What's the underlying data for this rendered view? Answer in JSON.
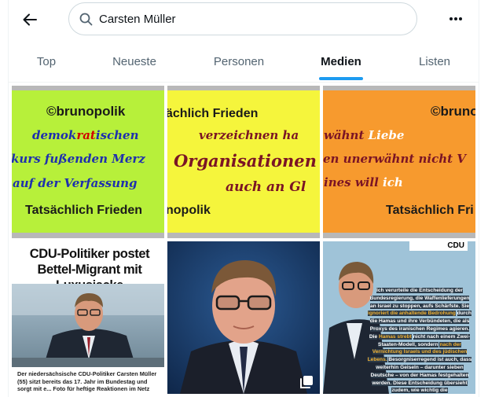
{
  "header": {
    "back_icon": "arrow-left-icon",
    "search_value": "Carsten Müller",
    "search_icon": "search-icon",
    "more_icon": "more-horizontal-icon"
  },
  "tabs": [
    {
      "label": "Top",
      "active": false
    },
    {
      "label": "Neueste",
      "active": false
    },
    {
      "label": "Personen",
      "active": false
    },
    {
      "label": "Medien",
      "active": true
    },
    {
      "label": "Listen",
      "active": false
    }
  ],
  "colors": {
    "accent": "#1d9bf0",
    "tile1_bg": "#b7f03a",
    "tile2_bg": "#f5f53c",
    "tile3_bg": "#f79a2e"
  },
  "media": {
    "tile1": {
      "line1": "©brunopolik",
      "line2a": "demok",
      "line2b": "rat",
      "line2c": "ischen",
      "line3": "kurs fußenden Merz",
      "line4": "auf der Verfassung",
      "line5": "Tatsächlich Frieden"
    },
    "tile2": {
      "line1": "ächlich Frieden",
      "line2": "verzeichnen ha",
      "line3": "Organisationen",
      "line4": "auch an Gl",
      "line5": "nopolik"
    },
    "tile3": {
      "line1": "©bruno",
      "line2a": "wähnt ",
      "line2b": "Liebe",
      "line3": "en unerwähnt nicht V",
      "line4a": "ines will ",
      "line4b": "ich",
      "line5": "Tatsächlich Fri"
    },
    "tile4": {
      "headline": "CDU-Politiker postet Bettel-Migrant mit Luxusjacke",
      "caption": "Der niedersächsische CDU-Politiker Carsten Müller (55) sitzt bereits das 17. Jahr im Bundestag und sorgt mit e... Foto für heftige Reaktionen im Netz"
    },
    "tile5": {
      "multi_icon": "multiple-images-icon"
    },
    "tile6": {
      "logo": "CDU",
      "p1": "Ich verurteile die Entscheidung der Bundesregierung, die Waffenlieferungen an Israel zu stoppen, aufs Schärfste. Sie",
      "p2": "ignoriert die anhaltende Bedrohung",
      "p3": "durch die Hamas und ihre Verbündeten, die als Proxys des iranischen Regimes agieren. Die",
      "p4": "Hamas strebt",
      "p5": "nicht nach einem Zwei-Staaten-Modell, sondern",
      "p6": "nach der Vernichtung Israels und des jüdischen Lebens.",
      "p7": "Besorgniserregend ist auch, dass weiterhin Geiseln – darunter sieben Deutsche – von der Hamas festgehalten werden. Diese Entscheidung übersieht zudem, wie wichtig die sicherheitspolitische Zusammenarbeit mit Israel für Deutschland"
    }
  }
}
